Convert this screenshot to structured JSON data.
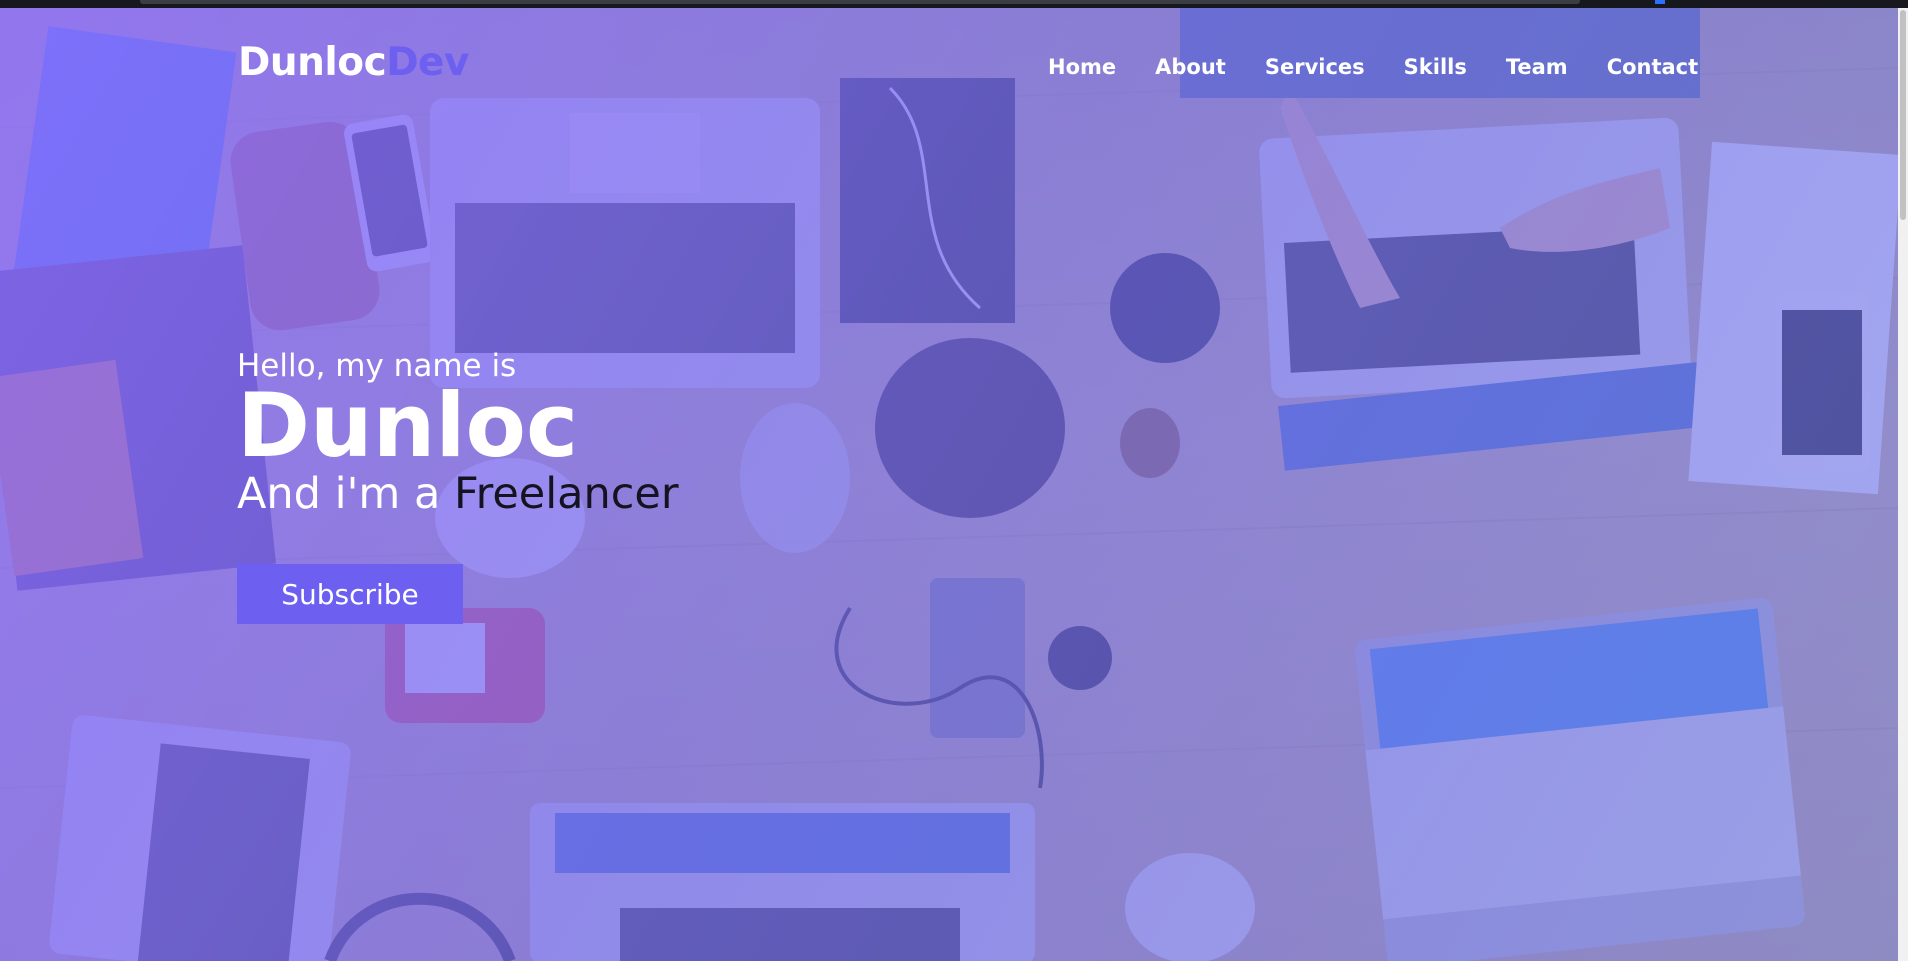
{
  "brand": {
    "name_part": "Dunloc",
    "accent_part": "Dev",
    "accent_color": "#6d5ff0"
  },
  "nav": {
    "items": [
      {
        "label": "Home"
      },
      {
        "label": "About"
      },
      {
        "label": "Services"
      },
      {
        "label": "Skills"
      },
      {
        "label": "Team"
      },
      {
        "label": "Contact"
      }
    ]
  },
  "hero": {
    "greeting": "Hello, my name is",
    "name": "Dunloc",
    "role_prefix": "And i'm a ",
    "role": "Freelancer",
    "subscribe_label": "Subscribe",
    "overlay_color": "#8c6eff"
  }
}
